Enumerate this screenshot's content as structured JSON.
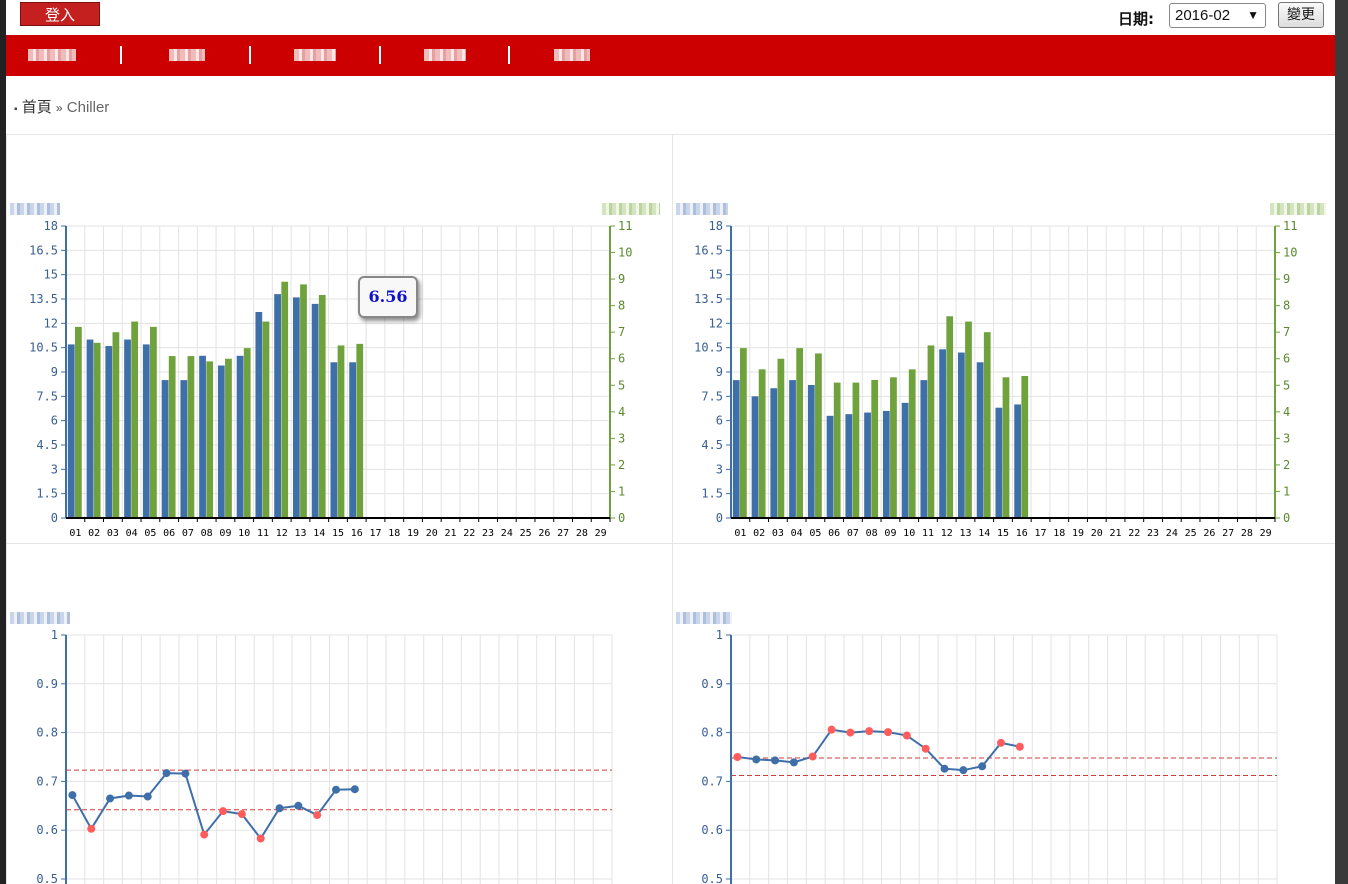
{
  "header": {
    "login_label": "登入",
    "date_label": "日期:",
    "date_value": "2016-02",
    "change_label": "變更"
  },
  "nav": {
    "items": [
      {
        "label": "Chiller"
      },
      {
        "label": ""
      },
      {
        "label": ""
      },
      {
        "label": ""
      },
      {
        "label": ""
      }
    ]
  },
  "breadcrumb": {
    "bullet": "▪",
    "home": "首頁",
    "separator": "»",
    "current": "Chiller"
  },
  "tooltip": {
    "value": "6.56"
  },
  "colors": {
    "blue_series": "#3f6fa8",
    "green_series": "#6fa23c",
    "nav_red": "#cc0000",
    "red_point": "#ff5d5d",
    "dashed_line": "#d23c3c"
  },
  "chart_data": [
    {
      "type": "bar",
      "title": "",
      "categories": [
        "01",
        "02",
        "03",
        "04",
        "05",
        "06",
        "07",
        "08",
        "09",
        "10",
        "11",
        "12",
        "13",
        "14",
        "15",
        "16",
        "17",
        "18",
        "19",
        "20",
        "21",
        "22",
        "23",
        "24",
        "25",
        "26",
        "27",
        "28",
        "29"
      ],
      "y_ticks_left": [
        "0",
        "1.5",
        "3",
        "4.5",
        "6",
        "7.5",
        "9",
        "10.5",
        "12",
        "13.5",
        "15",
        "16.5",
        "18"
      ],
      "y_ticks_right": [
        "0",
        "1",
        "2",
        "3",
        "4",
        "5",
        "6",
        "7",
        "8",
        "9",
        "10",
        "11"
      ],
      "ylim_left": [
        0,
        18
      ],
      "ylim_right": [
        0,
        11
      ],
      "series": [
        {
          "axis": "left",
          "values": [
            10.7,
            11,
            10.6,
            11,
            10.7,
            8.5,
            8.5,
            10,
            9.4,
            10,
            12.7,
            13.8,
            13.6,
            13.2,
            9.6,
            9.6
          ]
        },
        {
          "axis": "right",
          "values": [
            7.2,
            6.6,
            7,
            7.4,
            7.2,
            6.1,
            6.1,
            5.9,
            6,
            6.4,
            7.4,
            8.9,
            8.8,
            8.4,
            6.5,
            6.56
          ]
        }
      ],
      "grid": true
    },
    {
      "type": "bar",
      "title": "",
      "categories": [
        "01",
        "02",
        "03",
        "04",
        "05",
        "06",
        "07",
        "08",
        "09",
        "10",
        "11",
        "12",
        "13",
        "14",
        "15",
        "16",
        "17",
        "18",
        "19",
        "20",
        "21",
        "22",
        "23",
        "24",
        "25",
        "26",
        "27",
        "28",
        "29"
      ],
      "y_ticks_left": [
        "0",
        "1.5",
        "3",
        "4.5",
        "6",
        "7.5",
        "9",
        "10.5",
        "12",
        "13.5",
        "15",
        "16.5",
        "18"
      ],
      "y_ticks_right": [
        "0",
        "1",
        "2",
        "3",
        "4",
        "5",
        "6",
        "7",
        "8",
        "9",
        "10",
        "11"
      ],
      "ylim_left": [
        0,
        18
      ],
      "ylim_right": [
        0,
        11
      ],
      "series": [
        {
          "axis": "left",
          "values": [
            8.5,
            7.5,
            8,
            8.5,
            8.2,
            6.3,
            6.4,
            6.5,
            6.6,
            7.1,
            8.5,
            10.4,
            10.2,
            9.6,
            6.8,
            7
          ]
        },
        {
          "axis": "right",
          "values": [
            6.4,
            5.6,
            6,
            6.4,
            6.2,
            5.1,
            5.1,
            5.2,
            5.3,
            5.6,
            6.5,
            7.6,
            7.4,
            7,
            5.3,
            5.35
          ]
        }
      ],
      "grid": true
    },
    {
      "type": "line",
      "title": "",
      "y_ticks": [
        "0.5",
        "0.6",
        "0.7",
        "0.8",
        "0.9",
        "1"
      ],
      "ylim": [
        0.5,
        1.0
      ],
      "x_count": 29,
      "values": [
        0.672,
        0.603,
        0.665,
        0.671,
        0.669,
        0.717,
        0.716,
        0.591,
        0.639,
        0.633,
        0.583,
        0.645,
        0.65,
        0.631,
        0.683,
        0.684
      ],
      "thresholds": [
        0.642,
        0.723
      ],
      "grid": true
    },
    {
      "type": "line",
      "title": "",
      "y_ticks": [
        "0.5",
        "0.6",
        "0.7",
        "0.8",
        "0.9",
        "1"
      ],
      "ylim": [
        0.5,
        1.0
      ],
      "x_count": 29,
      "values": [
        0.75,
        0.745,
        0.743,
        0.739,
        0.751,
        0.806,
        0.8,
        0.803,
        0.801,
        0.794,
        0.767,
        0.726,
        0.723,
        0.731,
        0.779,
        0.771
      ],
      "thresholds": [
        0.712,
        0.748
      ],
      "grid": true
    }
  ]
}
